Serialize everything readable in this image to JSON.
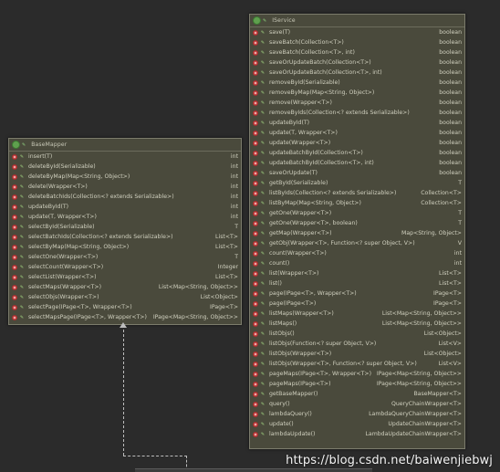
{
  "base_mapper": {
    "title": "BaseMapper",
    "methods": [
      {
        "sig": "insert(T)",
        "ret": "int"
      },
      {
        "sig": "deleteById(Serializable)",
        "ret": "int"
      },
      {
        "sig": "deleteByMap(Map<String, Object>)",
        "ret": "int"
      },
      {
        "sig": "delete(Wrapper<T>)",
        "ret": "int"
      },
      {
        "sig": "deleteBatchIds(Collection<? extends Serializable>)",
        "ret": "int"
      },
      {
        "sig": "updateById(T)",
        "ret": "int"
      },
      {
        "sig": "update(T, Wrapper<T>)",
        "ret": "int"
      },
      {
        "sig": "selectById(Serializable)",
        "ret": "T"
      },
      {
        "sig": "selectBatchIds(Collection<? extends Serializable>)",
        "ret": "List<T>"
      },
      {
        "sig": "selectByMap(Map<String, Object>)",
        "ret": "List<T>"
      },
      {
        "sig": "selectOne(Wrapper<T>)",
        "ret": "T"
      },
      {
        "sig": "selectCount(Wrapper<T>)",
        "ret": "Integer"
      },
      {
        "sig": "selectList(Wrapper<T>)",
        "ret": "List<T>"
      },
      {
        "sig": "selectMaps(Wrapper<T>)",
        "ret": "List<Map<String, Object>>"
      },
      {
        "sig": "selectObjs(Wrapper<T>)",
        "ret": "List<Object>"
      },
      {
        "sig": "selectPage(IPage<T>, Wrapper<T>)",
        "ret": "IPage<T>"
      },
      {
        "sig": "selectMapsPage(IPage<T>, Wrapper<T>)",
        "ret": "IPage<Map<String, Object>>"
      }
    ]
  },
  "iservice": {
    "title": "IService",
    "methods": [
      {
        "sig": "save(T)",
        "ret": "boolean"
      },
      {
        "sig": "saveBatch(Collection<T>)",
        "ret": "boolean"
      },
      {
        "sig": "saveBatch(Collection<T>, int)",
        "ret": "boolean"
      },
      {
        "sig": "saveOrUpdateBatch(Collection<T>)",
        "ret": "boolean"
      },
      {
        "sig": "saveOrUpdateBatch(Collection<T>, int)",
        "ret": "boolean"
      },
      {
        "sig": "removeById(Serializable)",
        "ret": "boolean"
      },
      {
        "sig": "removeByMap(Map<String, Object>)",
        "ret": "boolean"
      },
      {
        "sig": "remove(Wrapper<T>)",
        "ret": "boolean"
      },
      {
        "sig": "removeByIds(Collection<? extends Serializable>)",
        "ret": "boolean"
      },
      {
        "sig": "updateById(T)",
        "ret": "boolean"
      },
      {
        "sig": "update(T, Wrapper<T>)",
        "ret": "boolean"
      },
      {
        "sig": "update(Wrapper<T>)",
        "ret": "boolean"
      },
      {
        "sig": "updateBatchById(Collection<T>)",
        "ret": "boolean"
      },
      {
        "sig": "updateBatchById(Collection<T>, int)",
        "ret": "boolean"
      },
      {
        "sig": "saveOrUpdate(T)",
        "ret": "boolean"
      },
      {
        "sig": "getById(Serializable)",
        "ret": "T"
      },
      {
        "sig": "listByIds(Collection<? extends Serializable>)",
        "ret": "Collection<T>"
      },
      {
        "sig": "listByMap(Map<String, Object>)",
        "ret": "Collection<T>"
      },
      {
        "sig": "getOne(Wrapper<T>)",
        "ret": "T"
      },
      {
        "sig": "getOne(Wrapper<T>, boolean)",
        "ret": "T"
      },
      {
        "sig": "getMap(Wrapper<T>)",
        "ret": "Map<String, Object>"
      },
      {
        "sig": "getObj(Wrapper<T>, Function<? super Object, V>)",
        "ret": "V"
      },
      {
        "sig": "count(Wrapper<T>)",
        "ret": "int"
      },
      {
        "sig": "count()",
        "ret": "int"
      },
      {
        "sig": "list(Wrapper<T>)",
        "ret": "List<T>"
      },
      {
        "sig": "list()",
        "ret": "List<T>"
      },
      {
        "sig": "page(IPage<T>, Wrapper<T>)",
        "ret": "IPage<T>"
      },
      {
        "sig": "page(IPage<T>)",
        "ret": "IPage<T>"
      },
      {
        "sig": "listMaps(Wrapper<T>)",
        "ret": "List<Map<String, Object>>"
      },
      {
        "sig": "listMaps()",
        "ret": "List<Map<String, Object>>"
      },
      {
        "sig": "listObjs()",
        "ret": "List<Object>"
      },
      {
        "sig": "listObjs(Function<? super Object, V>)",
        "ret": "List<V>"
      },
      {
        "sig": "listObjs(Wrapper<T>)",
        "ret": "List<Object>"
      },
      {
        "sig": "listObjs(Wrapper<T>, Function<? super Object, V>)",
        "ret": "List<V>"
      },
      {
        "sig": "pageMaps(IPage<T>, Wrapper<T>)",
        "ret": "IPage<Map<String, Object>>"
      },
      {
        "sig": "pageMaps(IPage<T>)",
        "ret": "IPage<Map<String, Object>>"
      },
      {
        "sig": "getBaseMapper()",
        "ret": "BaseMapper<T>"
      },
      {
        "sig": "query()",
        "ret": "QueryChainWrapper<T>"
      },
      {
        "sig": "lambdaQuery()",
        "ret": "LambdaQueryChainWrapper<T>"
      },
      {
        "sig": "update()",
        "ret": "UpdateChainWrapper<T>"
      },
      {
        "sig": "lambdaUpdate()",
        "ret": "LambdaUpdateChainWrapper<T>"
      }
    ]
  },
  "watermark": "https://blog.csdn.net/baiwenjiebwj",
  "colors": {
    "panel_bg": "#4a4a3c",
    "method_icon": "#d04a4a",
    "interface_icon": "#5fa04e",
    "text": "#d0d0bf"
  }
}
